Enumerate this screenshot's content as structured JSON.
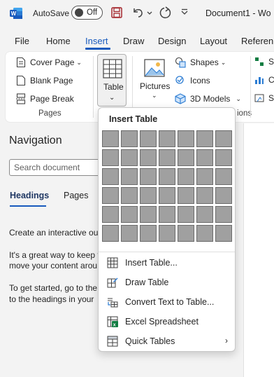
{
  "titlebar": {
    "autosave_label": "AutoSave",
    "toggle_state": "Off",
    "doc_title": "Document1 - Wo"
  },
  "tabs": [
    {
      "label": "File"
    },
    {
      "label": "Home"
    },
    {
      "label": "Insert",
      "active": true
    },
    {
      "label": "Draw"
    },
    {
      "label": "Design"
    },
    {
      "label": "Layout"
    },
    {
      "label": "Referen"
    }
  ],
  "ribbon": {
    "pages": {
      "cover_page": "Cover Page",
      "blank_page": "Blank Page",
      "page_break": "Page Break",
      "group_label": "Pages"
    },
    "table": {
      "label": "Table"
    },
    "illustrations": {
      "pictures": "Pictures",
      "shapes": "Shapes",
      "icons": "Icons",
      "models": "3D Models",
      "group_label_partial": "ions"
    },
    "partial_right": [
      "S",
      "C",
      "S"
    ]
  },
  "navigation": {
    "title": "Navigation",
    "search_placeholder": "Search document",
    "tabs": {
      "headings": "Headings",
      "pages": "Pages"
    },
    "lines": [
      "Create an interactive out",
      "It's a great way to keep t",
      "move your content arou",
      "To get started, go to the",
      "to the headings in your"
    ]
  },
  "insert_table": {
    "title": "Insert Table",
    "grid_columns": 7,
    "grid_rows": 6,
    "items": [
      {
        "label": "Insert Table...",
        "icon": "table-grid-icon"
      },
      {
        "label": "Draw Table",
        "icon": "pencil-table-icon"
      },
      {
        "label": "Convert Text to Table...",
        "icon": "convert-text-icon"
      },
      {
        "label": "Excel Spreadsheet",
        "icon": "excel-icon"
      },
      {
        "label": "Quick Tables",
        "icon": "quick-tables-icon",
        "submenu": true
      }
    ]
  },
  "colors": {
    "accent": "#185abd",
    "qat_save": "#a4262c",
    "excel_green": "#107c41"
  }
}
